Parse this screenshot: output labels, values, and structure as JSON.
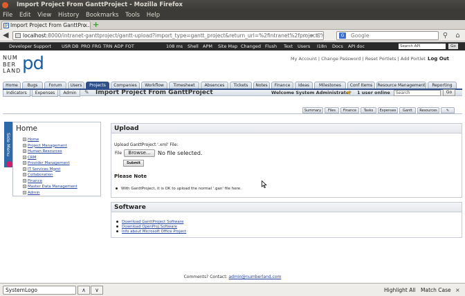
{
  "window": {
    "title": "Import Project From GanttProject - Mozilla Firefox"
  },
  "menu": [
    "File",
    "Edit",
    "View",
    "History",
    "Bookmarks",
    "Tools",
    "Help"
  ],
  "tab": {
    "title": "Import Project From GanttPro..."
  },
  "url": {
    "host": "localhost",
    "rest": ":8000/intranet-ganttproject/gantt-upload?import_type=gantt_project&return_url=%2fintranet%2fprojects%"
  },
  "search_engine": {
    "placeholder": "Google"
  },
  "devbar": {
    "left": "Developer Support",
    "items": [
      "USR",
      "DB",
      "PRO",
      "FRG",
      "TRN",
      "ADP",
      "FOT"
    ],
    "ms": "108 ms",
    "links": [
      "Shell",
      "APM",
      "Site Map",
      "Changed",
      "Flush",
      "Text",
      "Users",
      "I18n",
      "Docs",
      "API doc"
    ],
    "search_value": "Search API",
    "go": "Go"
  },
  "logo": {
    "text": "NUM\nBER\nLAND",
    "pd": "pd"
  },
  "header": {
    "links": "My Account | Change Password | Reset Portlets | Add Portlet",
    "logout": "Log Out"
  },
  "mainnav": [
    "Home",
    "Bugs",
    "Forum",
    "Users",
    "Projects",
    "Companies",
    "Workflow",
    "Timesheet",
    "Absences",
    "Tickets",
    "Notes",
    "Finance",
    "Ideas",
    "Milestones",
    "Conf Items",
    "Resource Management",
    "Reporting"
  ],
  "subnav": [
    "Indicators",
    "Expenses",
    "Admin"
  ],
  "page_title": "Import Project From GanttProject",
  "welcome": "Welcome System Administrator",
  "online": "1 user online",
  "site_search": {
    "placeholder": "Search",
    "go": "Go"
  },
  "project_tabs": [
    "Summary",
    "Files",
    "Finance",
    "Tasks",
    "Expenses",
    "Gantt",
    "Resources"
  ],
  "side_menu": {
    "label": "Side Menu"
  },
  "home_box": {
    "title": "Home",
    "items": [
      "Home",
      "Project Management",
      "Human Resources",
      "CRM",
      "Provider Management",
      "IT Services Mgmt",
      "Collaboration",
      "Finance",
      "Master Data Management",
      "Admin"
    ]
  },
  "upload": {
    "title": "Upload",
    "label": "Upload GanttProject '.xml' File:",
    "file_label": "File",
    "browse": "Browse...",
    "no_file": "No file selected.",
    "submit": "Submit",
    "note_title": "Please Note",
    "note": "With GanttProject, it is OK to upload the normal '.gan' file here."
  },
  "software": {
    "title": "Software",
    "links": [
      "Download GanttProject Software",
      "Download OpenProj Software",
      "Info about Microsoft Office Project"
    ]
  },
  "footer": {
    "text": "Comments? Contact: ",
    "email": "admin@numberland.com"
  },
  "findbar": {
    "value": "SystemLogo",
    "highlight": "Highlight All",
    "match_case": "Match Case"
  }
}
